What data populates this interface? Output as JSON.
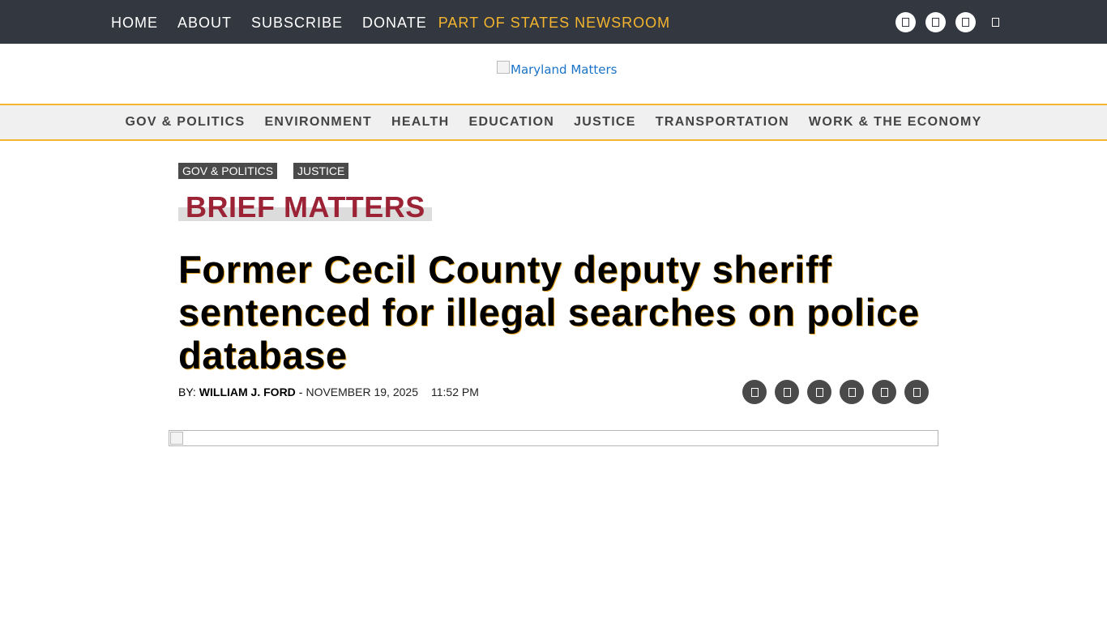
{
  "top_nav": {
    "items": [
      "HOME",
      "ABOUT",
      "SUBSCRIBE",
      "DONATE"
    ],
    "newsroom": "PART OF STATES NEWSROOM"
  },
  "social_top_icons": [
    "facebook-icon",
    "instagram-icon",
    "x-twitter-icon",
    "search-icon"
  ],
  "logo": {
    "alt": "Maryland Matters"
  },
  "category_nav": [
    "GOV & POLITICS",
    "ENVIRONMENT",
    "HEALTH",
    "EDUCATION",
    "JUSTICE",
    "TRANSPORTATION",
    "WORK & THE ECONOMY"
  ],
  "article": {
    "tags": [
      "GOV & POLITICS",
      "JUSTICE"
    ],
    "section_label": "BRIEF MATTERS",
    "headline": "Former Cecil County deputy sheriff sentenced for illegal searches on police database",
    "byline_prefix": "BY:",
    "author": "WILLIAM J. FORD",
    "separator": "-",
    "date": "NOVEMBER 19, 2025",
    "time": "11:52 PM"
  },
  "share_icons": [
    "facebook-share-icon",
    "x-share-icon",
    "email-share-icon",
    "linkedin-share-icon",
    "reddit-share-icon",
    "print-icon"
  ],
  "colors": {
    "topbar_bg": "#333840",
    "accent_gold": "#f5b52e",
    "brief_red": "#9b2335",
    "tag_bg": "#4a4a4a",
    "link_blue": "#1a73c8"
  }
}
